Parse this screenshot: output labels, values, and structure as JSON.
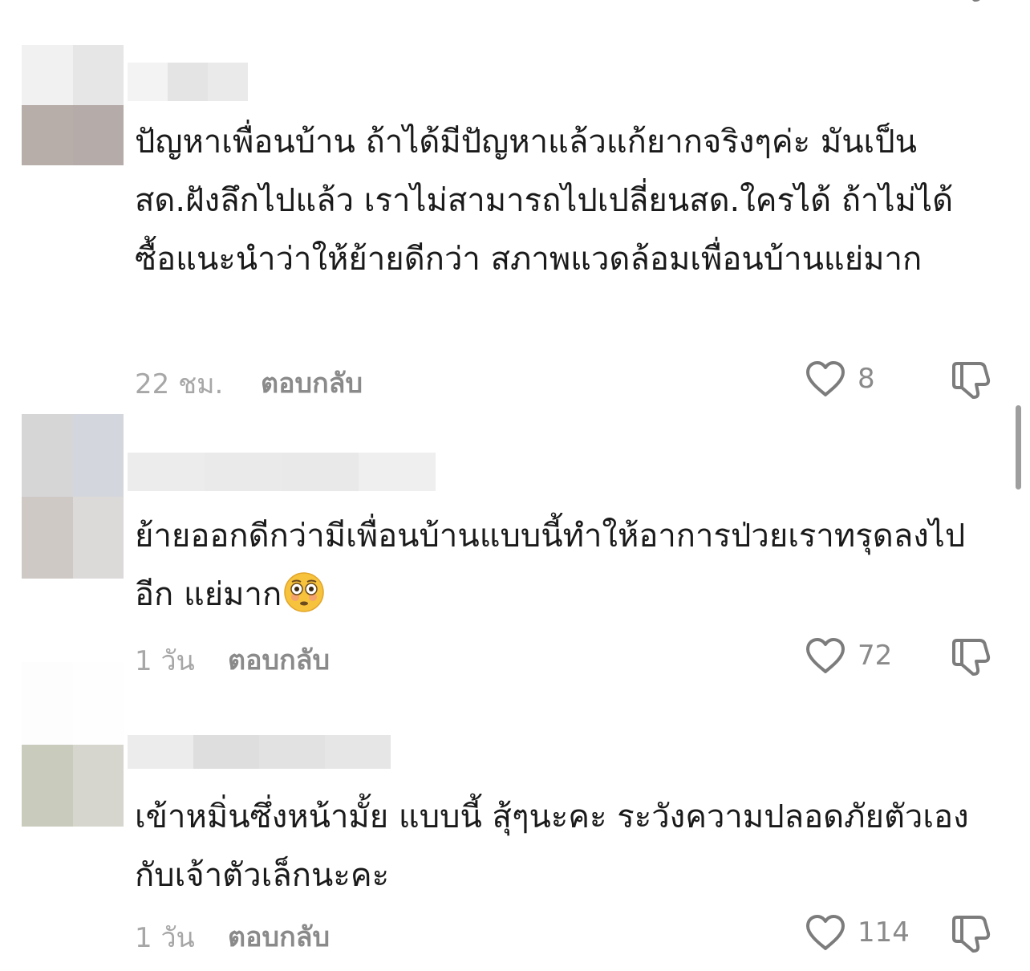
{
  "colors": {
    "text": "#1a1a1a",
    "muted": "#a7a7a7",
    "action": "#8a8a8a",
    "icon": "#7c7c7c"
  },
  "comments": [
    {
      "text": "ปัญหาเพื่อนบ้าน ถ้าได้มีปัญหาแล้วแก้ยากจริงๆค่ะ มันเป็นสด.ฝังลึกไปแล้ว เราไม่สามารถไปเปลี่ยนสด.ใครได้ ถ้าไม่ได้ซื้อแนะนำว่าให้ย้ายดีกว่า สภาพแวดล้อมเพื่อนบ้านแย่มาก",
      "timestamp": "22 ชม.",
      "reply_label": "ตอบกลับ",
      "like_count": "8",
      "avatar_colors": [
        "#f1f1f1",
        "#e6e6e6",
        "#b7aeaa",
        "#b5aba8"
      ],
      "username_colors": [
        "#f3f3f3",
        "#e4e4e4",
        "#eaeaea"
      ]
    },
    {
      "text": "ย้ายออกดีกว่ามีเพื่อนบ้านแบบนี้ทำให้อาการป่วยเราทรุดลงไปอีก แย่มาก",
      "emoji": "flushed-face-emoji",
      "timestamp": "1 วัน",
      "reply_label": "ตอบกลับ",
      "like_count": "72",
      "avatar_colors": [
        "#d6d6d6",
        "#d3d6dc",
        "#cfc9c6",
        "#dcd9d9"
      ],
      "username_colors": [
        "#ececec",
        "#eaeaea",
        "#e9e9e9",
        "#efefef"
      ]
    },
    {
      "text": "เข้าหมิ่นซึ่งหน้ามั้ย แบบนี้ สุ้ๆนะคะ ระวังความปลอดภัยตัวเองกับเจ้าตัวเล็กนะคะ",
      "timestamp": "1 วัน",
      "reply_label": "ตอบกลับ",
      "like_count": "114",
      "avatar_colors": [
        "#fdfdfe",
        "#fefefe",
        "#c9ccbc",
        "#d6d6ce"
      ],
      "username_colors": [
        "#ececec",
        "#dedede",
        "#e2e2e2",
        "#e6e6e6"
      ]
    }
  ]
}
